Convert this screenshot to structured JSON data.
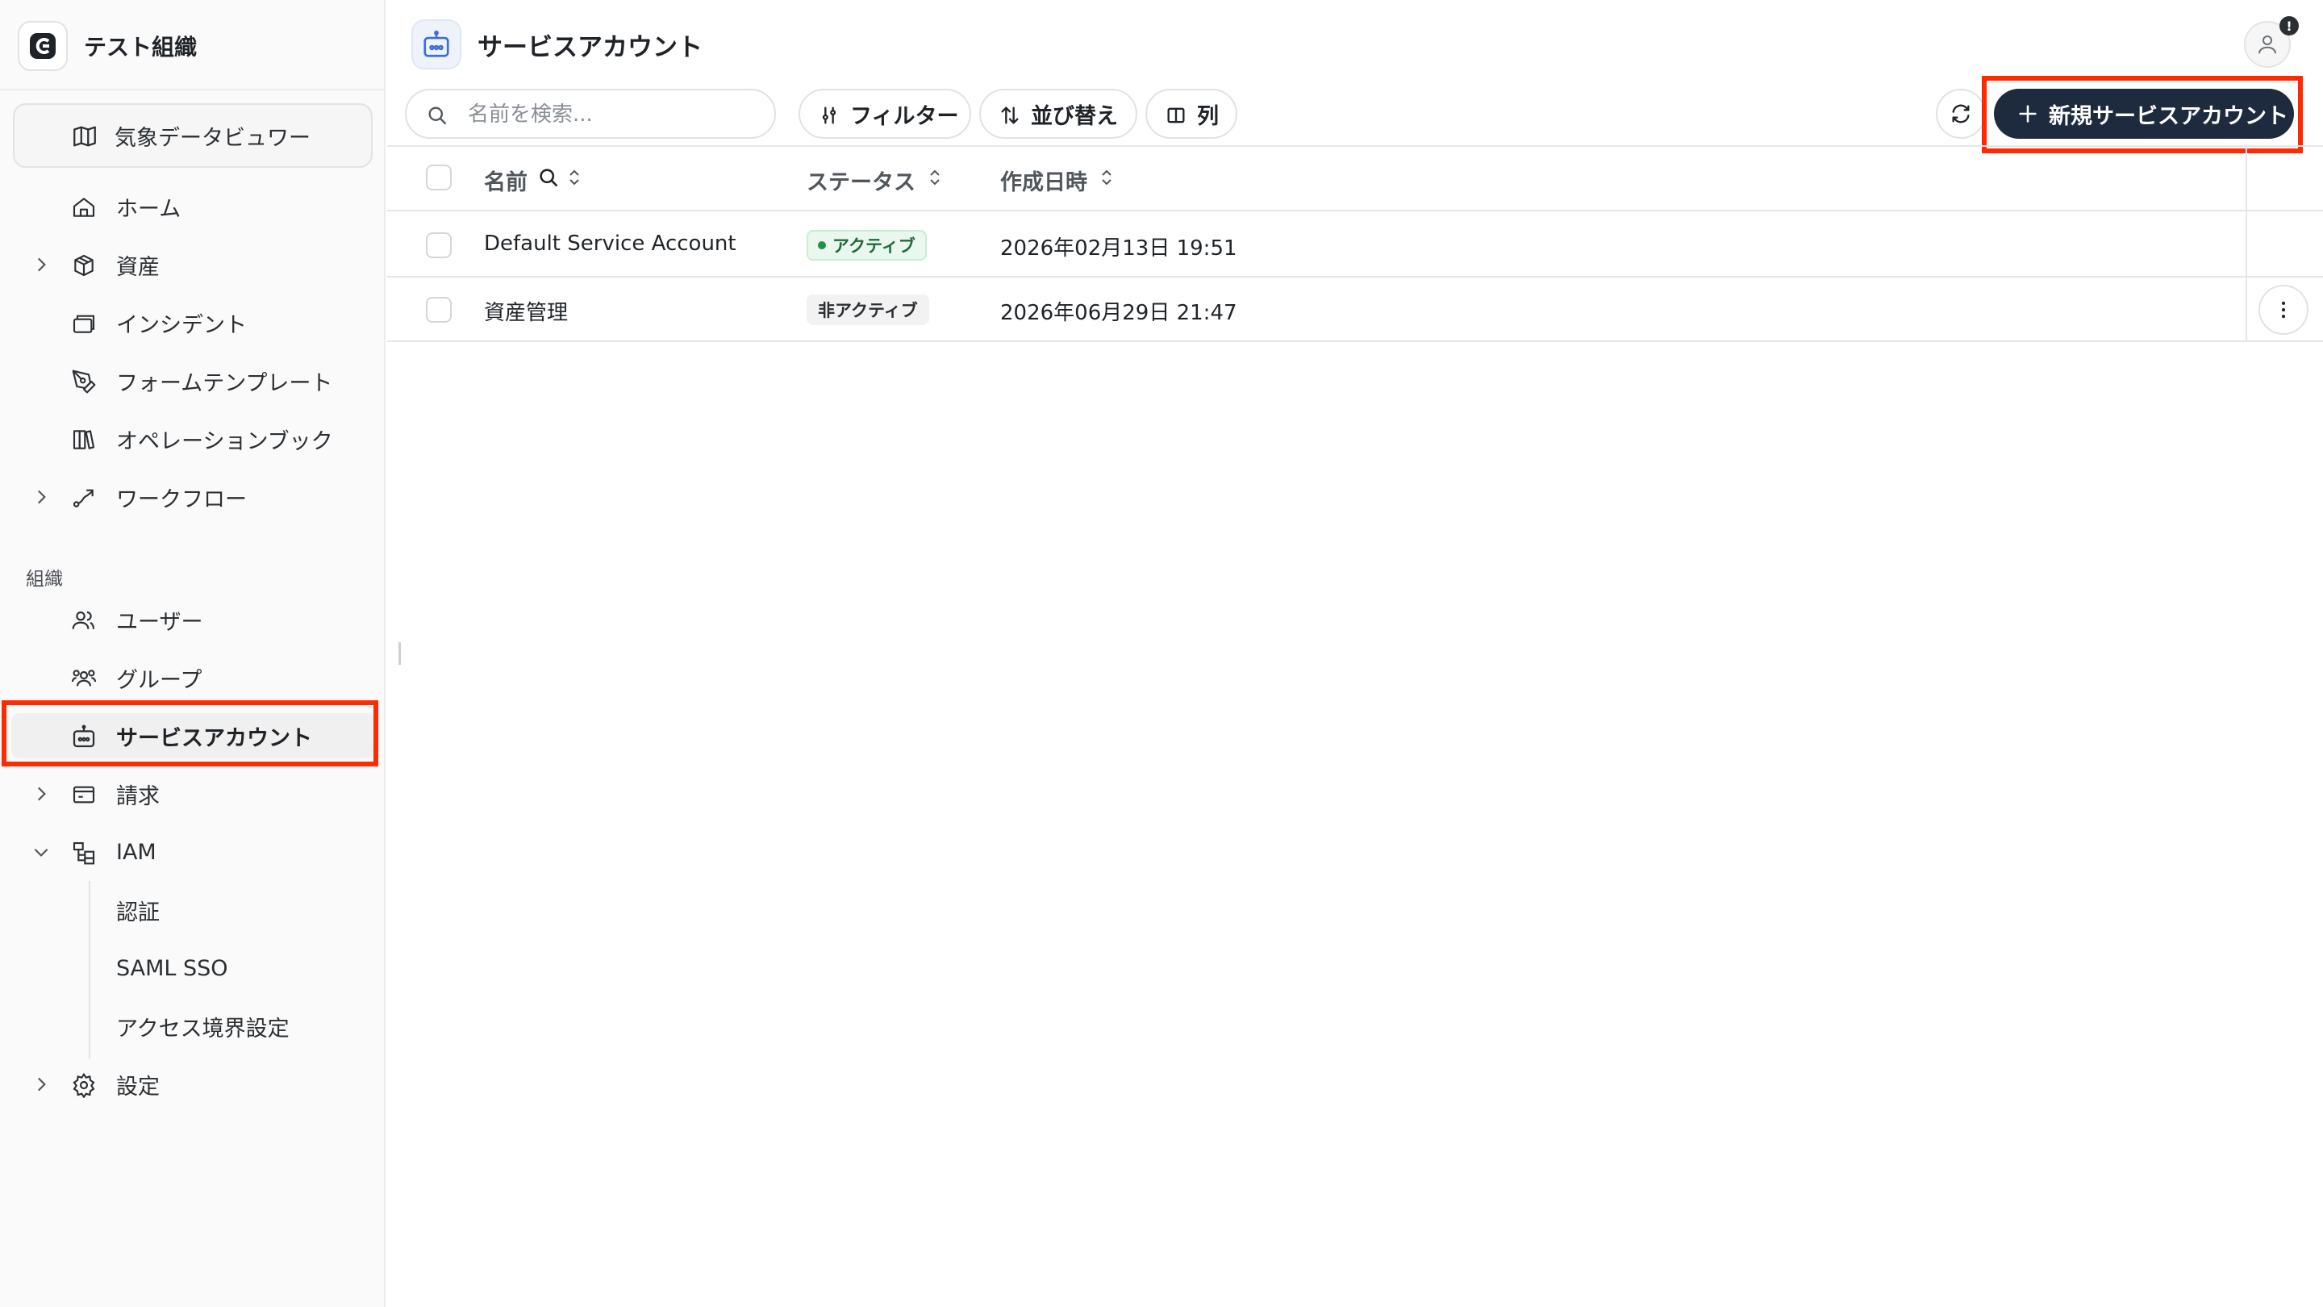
{
  "sidebar": {
    "org_name": "テスト組織",
    "viewer_label": "気象データビュワー",
    "items": [
      {
        "label": "ホーム"
      },
      {
        "label": "資産"
      },
      {
        "label": "インシデント"
      },
      {
        "label": "フォームテンプレート"
      },
      {
        "label": "オペレーションブック"
      },
      {
        "label": "ワークフロー"
      }
    ],
    "group_title": "組織",
    "org_items": [
      {
        "label": "ユーザー"
      },
      {
        "label": "グループ"
      },
      {
        "label": "サービスアカウント"
      },
      {
        "label": "請求"
      },
      {
        "label": "IAM"
      }
    ],
    "iam_sub": [
      {
        "label": "認証"
      },
      {
        "label": "SAML SSO"
      },
      {
        "label": "アクセス境界設定"
      }
    ],
    "settings_label": "設定"
  },
  "header": {
    "title": "サービスアカウント",
    "notification_badge": "!"
  },
  "toolbar": {
    "search_placeholder": "名前を検索...",
    "filter_label": "フィルター",
    "sort_label": "並び替え",
    "columns_label": "列",
    "new_button_label": "新規サービスアカウント"
  },
  "table": {
    "columns": [
      "名前",
      "ステータス",
      "作成日時"
    ],
    "rows": [
      {
        "name": "Default Service Account",
        "status": "アクティブ",
        "created": "2026年02月13日 19:51"
      },
      {
        "name": "資産管理",
        "status": "非アクティブ",
        "created": "2026年06月29日 21:47"
      }
    ]
  },
  "colors": {
    "accent_highlight": "#ff2a00",
    "primary_button": "#1e2a3d",
    "active_badge": "#1f8f4a"
  }
}
